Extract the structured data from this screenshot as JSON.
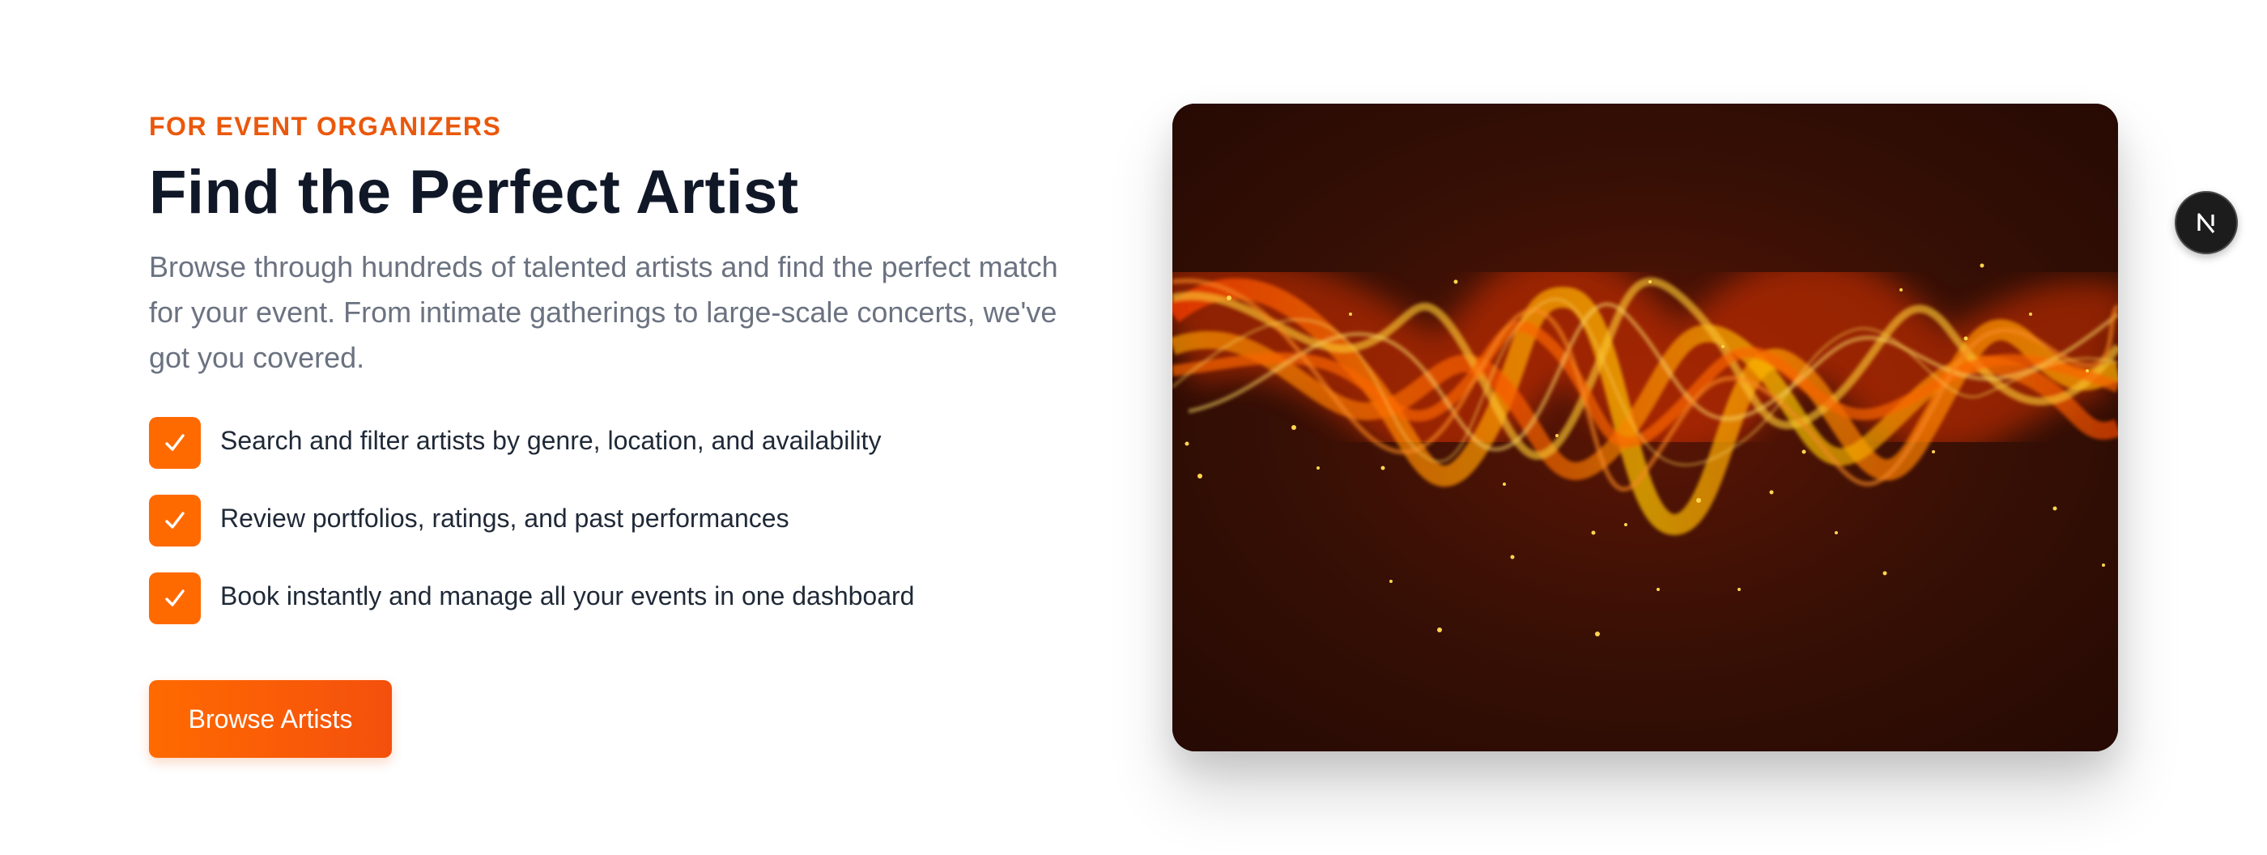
{
  "hero": {
    "eyebrow": "FOR EVENT ORGANIZERS",
    "title": "Find the Perfect Artist",
    "description": "Browse through hundreds of talented artists and find the perfect match for your event. From intimate gatherings to large-scale concerts, we've got you covered.",
    "features": [
      {
        "icon": "check-icon",
        "text": "Search and filter artists by genre, location, and availability"
      },
      {
        "icon": "check-icon",
        "text": "Review portfolios, ratings, and past performances"
      },
      {
        "icon": "check-icon",
        "text": "Book instantly and manage all your events in one dashboard"
      }
    ],
    "cta_label": "Browse Artists",
    "image_subject": "fiery orange sound wave on dark background"
  },
  "badge": {
    "icon": "nextjs-logo-icon",
    "letter": "N"
  },
  "colors": {
    "accent": "#ff6a00",
    "eyebrow": "#ea580c",
    "heading": "#101828",
    "body_text": "#6b7280",
    "feature_text": "#1f2937",
    "image_bg": "#2b0d04"
  }
}
